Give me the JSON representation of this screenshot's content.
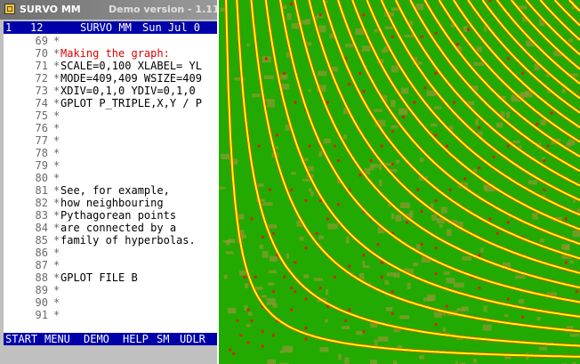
{
  "window": {
    "title": "SURVO MM",
    "version": "Demo version - 1.11",
    "icon": "survo-app-icon"
  },
  "status_bar": {
    "window_number": "1",
    "line_number": "12",
    "app_name": "SURVO MM",
    "date": "Sun Jul 0"
  },
  "edit_lines": [
    {
      "num": "69",
      "ctl": "*",
      "text": ""
    },
    {
      "num": "70",
      "ctl": "*",
      "text": "Making the graph:",
      "highlight": true
    },
    {
      "num": "71",
      "ctl": "*",
      "text": "SCALE=0,100 XLABEL= YL"
    },
    {
      "num": "72",
      "ctl": "*",
      "text": "MODE=409,409 WSIZE=409"
    },
    {
      "num": "73",
      "ctl": "*",
      "text": "XDIV=0,1,0 YDIV=0,1,0"
    },
    {
      "num": "74",
      "ctl": "*",
      "text": "GPLOT P_TRIPLE,X,Y / P"
    },
    {
      "num": "75",
      "ctl": "*",
      "text": ""
    },
    {
      "num": "76",
      "ctl": "*",
      "text": ""
    },
    {
      "num": "77",
      "ctl": "*",
      "text": ""
    },
    {
      "num": "78",
      "ctl": "*",
      "text": ""
    },
    {
      "num": "79",
      "ctl": "*",
      "text": ""
    },
    {
      "num": "80",
      "ctl": "*",
      "text": ""
    },
    {
      "num": "81",
      "ctl": "*",
      "text": "See, for example,"
    },
    {
      "num": "82",
      "ctl": "*",
      "text": "how neighbouring"
    },
    {
      "num": "83",
      "ctl": "*",
      "text": "Pythagorean points"
    },
    {
      "num": "84",
      "ctl": "*",
      "text": "are connected by a"
    },
    {
      "num": "85",
      "ctl": "*",
      "text": "family of hyperbolas."
    },
    {
      "num": "86",
      "ctl": "*",
      "text": ""
    },
    {
      "num": "87",
      "ctl": "*",
      "text": ""
    },
    {
      "num": "88",
      "ctl": "*",
      "text": "GPLOT FILE B"
    },
    {
      "num": "89",
      "ctl": "*",
      "text": ""
    },
    {
      "num": "90",
      "ctl": "*",
      "text": ""
    },
    {
      "num": "91",
      "ctl": "*",
      "text": ""
    }
  ],
  "command_bar": [
    "START",
    "MENU",
    "DEMO",
    "HELP",
    "SM",
    "UDLR"
  ],
  "colors": {
    "statusbar_bg": "#0000aa",
    "statusbar_fg": "#ffffff",
    "highlight_text": "#e00000",
    "plot_background": "#22aa00",
    "curve": "#ffff00",
    "curve_edge": "#ff3a00",
    "point": "#cc2a00",
    "patch": "#8a9a30"
  },
  "chart_data": {
    "type": "scatter",
    "title": "",
    "xlabel": "",
    "ylabel": "",
    "xlim": [
      0,
      100
    ],
    "ylim": [
      0,
      100
    ],
    "grid": false,
    "series": [
      {
        "kind": "hyperbola_family",
        "equation": "x*y = c",
        "c": [
          200,
          500,
          900,
          1300,
          1700,
          2100,
          2500,
          2900,
          3300,
          3700,
          4100,
          4500,
          4900,
          5300,
          5700,
          6100,
          6500,
          6900,
          7300,
          7700,
          8100,
          8500,
          8900,
          9300,
          9700
        ]
      },
      {
        "kind": "pythagorean_points",
        "rule": "a^2 + b^2 = c^2",
        "range": [
          1,
          100
        ]
      }
    ]
  }
}
